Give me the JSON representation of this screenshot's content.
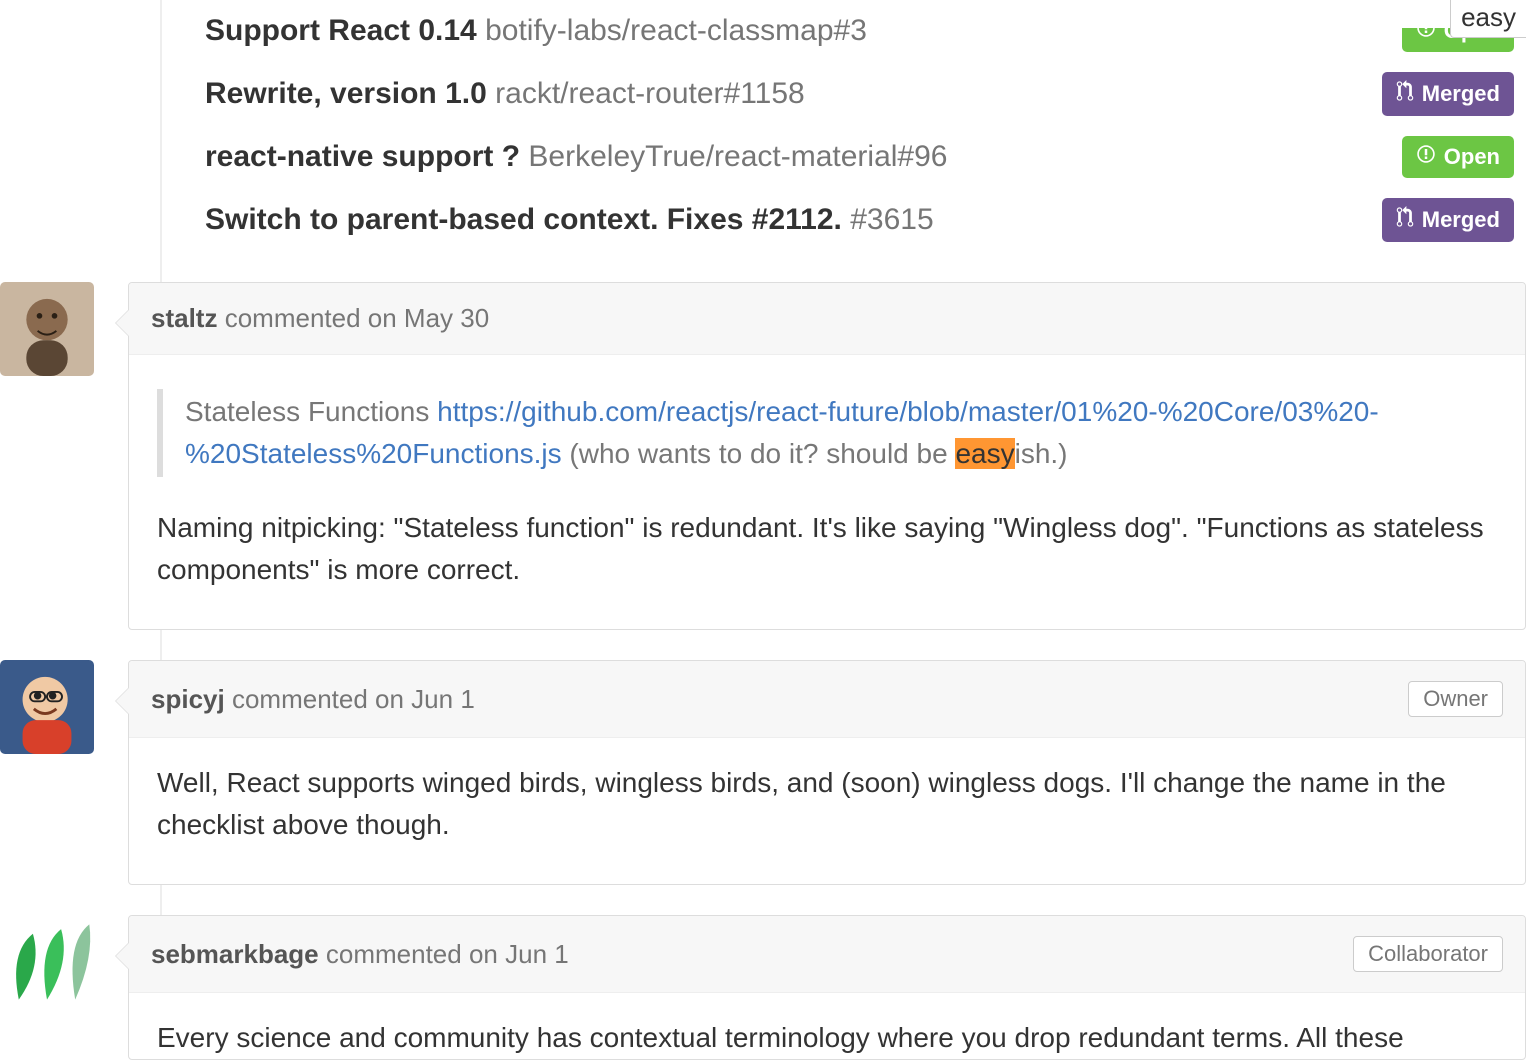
{
  "find_bar": {
    "query": "easy"
  },
  "references": [
    {
      "title": "Support React 0.14",
      "repo": "botify-labs/react-classmap#3",
      "state": "Open",
      "badge_class": "badge-open",
      "icon": "issue",
      "cut_top": true
    },
    {
      "title": "Rewrite, version 1.0",
      "repo": "rackt/react-router#1158",
      "state": "Merged",
      "badge_class": "badge-merged",
      "icon": "pr",
      "cut_top": false
    },
    {
      "title": "react-native support ?",
      "repo": "BerkeleyTrue/react-material#96",
      "state": "Open",
      "badge_class": "badge-open",
      "icon": "issue",
      "cut_top": false
    },
    {
      "title": "Switch to parent-based context. Fixes #2112.",
      "repo": "#3615",
      "state": "Merged",
      "badge_class": "badge-merged",
      "icon": "pr",
      "cut_top": false
    }
  ],
  "comments": [
    {
      "author": "staltz",
      "timestamp_prefix": "commented ",
      "timestamp": "on May 30",
      "role": "",
      "quote": {
        "prefix": "Stateless Functions ",
        "link": "https://github.com/reactjs/react-future/blob/master/01%20-%20Core/03%20-%20Stateless%20Functions.js",
        "tail_before_highlight": " (who wants to do it? should be ",
        "highlight": "easy",
        "tail_after_highlight": "ish.)"
      },
      "body": "Naming nitpicking: \"Stateless function\" is redundant. It's like saying \"Wingless dog\". \"Functions as stateless components\" is more correct."
    },
    {
      "author": "spicyj",
      "timestamp_prefix": "commented ",
      "timestamp": "on Jun 1",
      "role": "Owner",
      "body": "Well, React supports winged birds, wingless birds, and (soon) wingless dogs. I'll change the name in the checklist above though."
    },
    {
      "author": "sebmarkbage",
      "timestamp_prefix": "commented ",
      "timestamp": "on Jun 1",
      "role": "Collaborator",
      "body_partial": "Every science and community has contextual terminology where you drop redundant terms. All these"
    }
  ]
}
